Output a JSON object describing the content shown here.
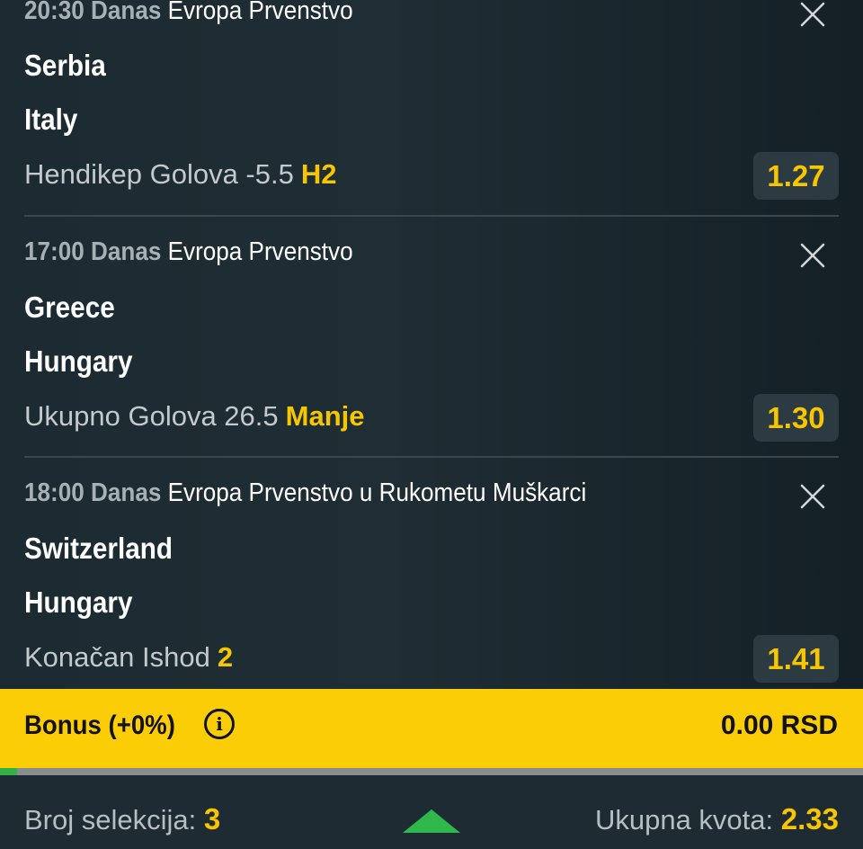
{
  "selections": [
    {
      "time": "20:30",
      "day": "Danas",
      "competition": "Evropa Prvenstvo",
      "home_team": "Serbia",
      "away_team": "Italy",
      "market": "Hendikep Golova -5.5",
      "pick": "H2",
      "odds": "1.27"
    },
    {
      "time": "17:00",
      "day": "Danas",
      "competition": "Evropa Prvenstvo",
      "home_team": "Greece",
      "away_team": "Hungary",
      "market": "Ukupno Golova 26.5",
      "pick": "Manje",
      "odds": "1.30"
    },
    {
      "time": "18:00",
      "day": "Danas",
      "competition": "Evropa Prvenstvo u Rukometu Muškarci",
      "home_team": "Switzerland",
      "away_team": "Hungary",
      "market": "Konačan Ishod",
      "pick": "2",
      "odds": "1.41"
    }
  ],
  "bonus": {
    "label": "Bonus (+0%)",
    "info_icon": "i",
    "amount": "0.00 RSD"
  },
  "progress": {
    "fraction": 0.02
  },
  "footer": {
    "count_label": "Broj selekcija:",
    "count_value": "3",
    "total_label": "Ukupna kvota:",
    "total_value": "2.33"
  },
  "colors": {
    "accent": "#f7c600",
    "bonus_bar": "#fbcd07",
    "progress_fill": "#33b24a",
    "background": "#1e2b32"
  }
}
